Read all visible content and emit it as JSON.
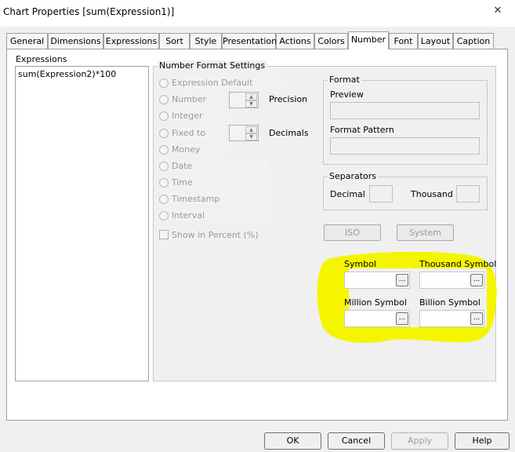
{
  "window": {
    "title": "Chart Properties [sum(Expression1)]",
    "close_icon": "close-icon"
  },
  "tabs": [
    {
      "label": "General"
    },
    {
      "label": "Dimensions"
    },
    {
      "label": "Expressions"
    },
    {
      "label": "Sort"
    },
    {
      "label": "Style"
    },
    {
      "label": "Presentation"
    },
    {
      "label": "Actions"
    },
    {
      "label": "Colors"
    },
    {
      "label": "Number"
    },
    {
      "label": "Font"
    },
    {
      "label": "Layout"
    },
    {
      "label": "Caption"
    }
  ],
  "active_tab": "Number",
  "expressions": {
    "label": "Expressions",
    "items": [
      "sum(Expression2)*100"
    ]
  },
  "number_format": {
    "title": "Number Format Settings",
    "options": [
      "Expression Default",
      "Number",
      "Integer",
      "Fixed to",
      "Money",
      "Date",
      "Time",
      "Timestamp",
      "Interval"
    ],
    "precision_label": "Precision",
    "decimals_label": "Decimals",
    "show_in_percent": "Show in Percent (%)"
  },
  "format": {
    "title": "Format",
    "preview_label": "Preview",
    "pattern_label": "Format Pattern"
  },
  "separators": {
    "title": "Separators",
    "decimal_label": "Decimal",
    "thousand_label": "Thousand"
  },
  "buttons": {
    "iso": "ISO",
    "system": "System"
  },
  "symbols": {
    "symbol_label": "Symbol",
    "thousand_label": "Thousand Symbol",
    "million_label": "Million Symbol",
    "billion_label": "Billion Symbol",
    "browse": "...",
    "highlight_color": "#f5f500"
  },
  "footer": {
    "ok": "OK",
    "cancel": "Cancel",
    "apply": "Apply",
    "help": "Help"
  }
}
